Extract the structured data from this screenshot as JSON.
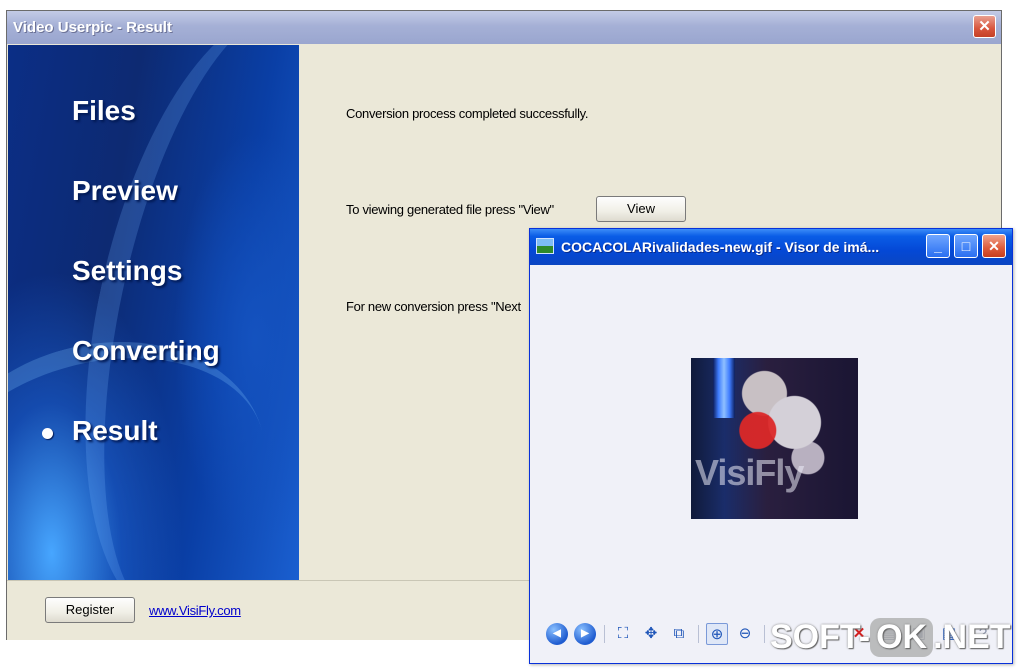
{
  "main_window": {
    "title": "Video Userpic - Result",
    "close_glyph": "✕"
  },
  "sidebar": {
    "items": [
      {
        "label": "Files",
        "active": false
      },
      {
        "label": "Preview",
        "active": false
      },
      {
        "label": "Settings",
        "active": false
      },
      {
        "label": "Converting",
        "active": false
      },
      {
        "label": "Result",
        "active": true
      }
    ]
  },
  "content": {
    "message": "Conversion process completed successfully.",
    "view_prompt": "To viewing generated file press \"View\"",
    "view_button": "View",
    "next_prompt": "For new conversion press \"Next"
  },
  "footer": {
    "register_button": "Register",
    "link": "www.VisiFly.com"
  },
  "viewer": {
    "title": "COCACOLARivalidades-new.gif - Visor de imá...",
    "minimize_glyph": "_",
    "maximize_glyph": "□",
    "close_glyph": "✕",
    "image_watermark": "VisiFly",
    "toolbar": [
      {
        "icon": "previous-icon",
        "glyph": "◀"
      },
      {
        "icon": "next-icon",
        "glyph": "▶"
      },
      {
        "icon": "best-fit-icon",
        "glyph": "⛶"
      },
      {
        "icon": "actual-size-icon",
        "glyph": "✥"
      },
      {
        "icon": "slideshow-icon",
        "glyph": "⧉"
      },
      {
        "icon": "zoom-in-icon",
        "glyph": "⊕"
      },
      {
        "icon": "zoom-out-icon",
        "glyph": "⊖"
      },
      {
        "icon": "delete-icon",
        "glyph": "✕"
      },
      {
        "icon": "print-icon",
        "glyph": "▤"
      },
      {
        "icon": "save-icon",
        "glyph": "▣"
      },
      {
        "icon": "edit-icon",
        "glyph": "▦"
      },
      {
        "icon": "help-icon",
        "glyph": "?"
      }
    ]
  },
  "watermark": {
    "prefix": "SOFT-",
    "ok": "OK",
    "suffix": ".NET"
  }
}
